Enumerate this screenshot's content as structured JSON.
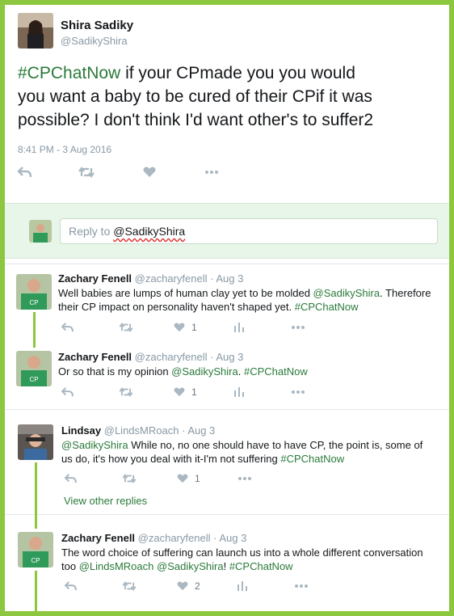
{
  "main_tweet": {
    "author_name": "Shira Sadiky",
    "author_handle": "@SadikyShira",
    "hashtag": "#CPChatNow",
    "text_line1": " if your CPmade you you would",
    "text_line2": "you want a baby to be cured of their CPif it was",
    "text_line3": "possible? I don't think I'd want other's to suffer2",
    "timestamp": "8:41 PM - 3 Aug 2016"
  },
  "reply_box": {
    "prefix": "Reply to ",
    "mention": "@SadikyShira"
  },
  "replies": [
    {
      "author_name": "Zachary Fenell",
      "author_handle": "@zacharyfenell",
      "date": "Aug 3",
      "line1_pre": "Well babies are lumps of human clay yet to be molded ",
      "line1_mention": "@SadikyShira",
      "line1_post": ". Therefore",
      "line2_pre": "their CP impact on personality haven't shaped yet. ",
      "line2_hashtag": "#CPChatNow",
      "likes": "1"
    },
    {
      "author_name": "Zachary Fenell",
      "author_handle": "@zacharyfenell",
      "date": "Aug 3",
      "line1_pre": "Or so that is my opinion ",
      "line1_mention": "@SadikyShira",
      "line1_post": ". ",
      "line1_hashtag": "#CPChatNow",
      "likes": "1"
    },
    {
      "author_name": "Lindsay",
      "author_handle": "@LindsMRoach",
      "date": "Aug 3",
      "line1_mention": "@SadikyShira",
      "line1_post": " While no, no one should have to have CP, the point is, some of",
      "line2_pre": "us do, it's how you deal with it-I'm not suffering ",
      "line2_hashtag": "#CPChatNow",
      "likes": "1",
      "view_other_replies": "View other replies"
    },
    {
      "author_name": "Zachary Fenell",
      "author_handle": "@zacharyfenell",
      "date": "Aug 3",
      "line1": "The word choice of suffering can launch us into a whole different conversation",
      "line2_pre": "too ",
      "line2_mention1": "@LindsMRoach",
      "line2_space": " ",
      "line2_mention2": "@SadikyShira",
      "line2_mid": "! ",
      "line2_hashtag": "#CPChatNow",
      "likes": "2"
    }
  ],
  "colors": {
    "frame_border": "#8dc63f",
    "link_green": "#2a7a3a",
    "muted": "#8899a6",
    "icon": "#aab8c2",
    "reply_box_bg": "#e8f5e9"
  },
  "icons": {
    "reply": "reply-icon",
    "retweet": "retweet-icon",
    "like": "heart-icon",
    "analytics": "analytics-icon",
    "more": "more-icon"
  }
}
